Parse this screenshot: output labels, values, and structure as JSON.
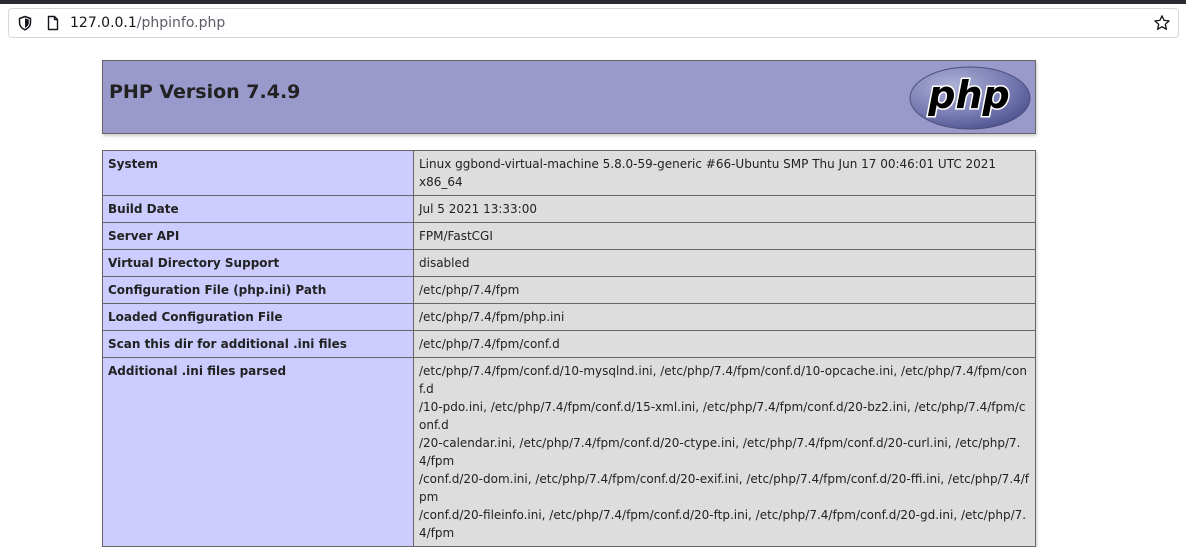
{
  "browser": {
    "url_host": "127.0.0.1",
    "url_path": "/phpinfo.php"
  },
  "icons": {
    "shield": "shield-icon",
    "page": "page-icon",
    "star": "star-icon",
    "logo": "php-logo"
  },
  "colors": {
    "header_bg": "#9999cc",
    "label_bg": "#ccccff",
    "value_bg": "#dddddd",
    "border": "#666666"
  },
  "header": {
    "title": "PHP Version 7.4.9",
    "logo_text": "php"
  },
  "rows": [
    {
      "label": "System",
      "value": "Linux ggbond-virtual-machine 5.8.0-59-generic #66-Ubuntu SMP Thu Jun 17 00:46:01 UTC 2021 x86_64"
    },
    {
      "label": "Build Date",
      "value": "Jul 5 2021 13:33:00"
    },
    {
      "label": "Server API",
      "value": "FPM/FastCGI"
    },
    {
      "label": "Virtual Directory Support",
      "value": "disabled"
    },
    {
      "label": "Configuration File (php.ini) Path",
      "value": "/etc/php/7.4/fpm"
    },
    {
      "label": "Loaded Configuration File",
      "value": "/etc/php/7.4/fpm/php.ini"
    },
    {
      "label": "Scan this dir for additional .ini files",
      "value": "/etc/php/7.4/fpm/conf.d"
    },
    {
      "label": "Additional .ini files parsed",
      "value_lines": [
        "/etc/php/7.4/fpm/conf.d/10-mysqlnd.ini, /etc/php/7.4/fpm/conf.d/10-opcache.ini, /etc/php/7.4/fpm/conf.d",
        "/10-pdo.ini, /etc/php/7.4/fpm/conf.d/15-xml.ini, /etc/php/7.4/fpm/conf.d/20-bz2.ini, /etc/php/7.4/fpm/conf.d",
        "/20-calendar.ini, /etc/php/7.4/fpm/conf.d/20-ctype.ini, /etc/php/7.4/fpm/conf.d/20-curl.ini, /etc/php/7.4/fpm",
        "/conf.d/20-dom.ini, /etc/php/7.4/fpm/conf.d/20-exif.ini, /etc/php/7.4/fpm/conf.d/20-ffi.ini, /etc/php/7.4/fpm",
        "/conf.d/20-fileinfo.ini, /etc/php/7.4/fpm/conf.d/20-ftp.ini, /etc/php/7.4/fpm/conf.d/20-gd.ini, /etc/php/7.4/fpm"
      ]
    }
  ]
}
